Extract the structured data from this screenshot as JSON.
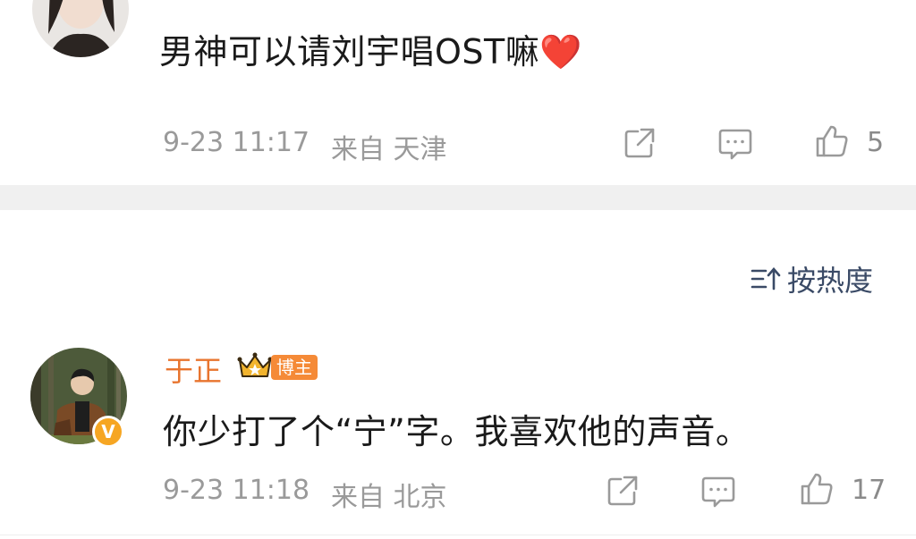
{
  "comments": [
    {
      "text": "男神可以请刘宇唱OST嘛",
      "heart_emoji": "❤️",
      "time": "9-23 11:17",
      "location": "来自 天津",
      "likes": "5"
    },
    {
      "username": "于正",
      "badge": "博主",
      "text": "你少打了个“宁”字。我喜欢他的声音。",
      "time": "9-23 11:18",
      "location": "来自 北京",
      "likes": "17"
    }
  ],
  "sort": {
    "label": "按热度"
  },
  "colors": {
    "username": "#e8742e",
    "badge_bg": "#f58a37",
    "meta_gray": "#9a9a9a",
    "sort_blue": "#3a4a66",
    "heart": "#e23b3b"
  },
  "icons": [
    "share-icon",
    "comment-icon",
    "like-icon",
    "sort-icon",
    "crown-icon",
    "verified-icon"
  ]
}
